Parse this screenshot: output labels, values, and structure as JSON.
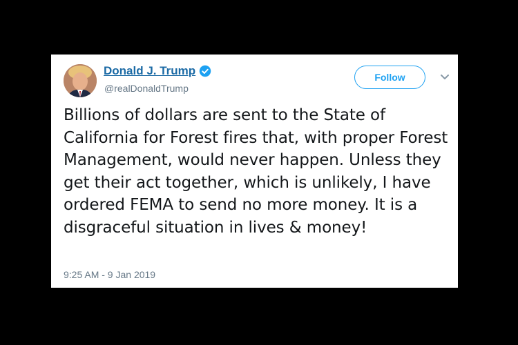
{
  "tweet": {
    "author": {
      "display_name": "Donald J. Trump",
      "handle": "@realDonaldTrump",
      "verified": true,
      "avatar_icon": "profile-photo"
    },
    "follow_label": "Follow",
    "menu_icon": "chevron-down-icon",
    "text": "Billions of dollars are sent to the State of California for Forest fires that, with proper Forest Management, would never happen. Unless they get their act together, which is unlikely, I have ordered FEMA to send no more money. It is a disgraceful situation in lives & money!",
    "timestamp": "9:25 AM - 9 Jan 2019"
  },
  "colors": {
    "background": "#000000",
    "card": "#ffffff",
    "accent": "#1da1f2",
    "name_link": "#1b6aa5",
    "muted": "#657786",
    "text": "#14171a"
  }
}
